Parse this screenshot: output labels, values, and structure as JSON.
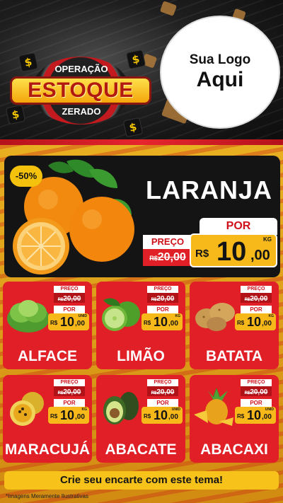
{
  "header": {
    "badge_top": "OPERAÇÃO",
    "badge_main": "ESTOQUE",
    "badge_bottom": "ZERADO",
    "logo_line1": "Sua Logo",
    "logo_line2": "Aqui",
    "dollar_symbol": "$"
  },
  "hero": {
    "discount": "-50%",
    "name": "LARANJA",
    "preco_label": "PREÇO",
    "old_currency": "R$",
    "old_value": "20,00",
    "por_label": "POR",
    "new_currency": "R$",
    "new_int": "10",
    "new_dec": ",00",
    "unit": "KG",
    "icon": "orange-icon"
  },
  "products": [
    {
      "name": "ALFACE",
      "preco_label": "PREÇO",
      "old_currency": "R$",
      "old_value": "20,00",
      "por_label": "POR",
      "new_currency": "R$",
      "new_int": "10",
      "new_dec": ",00",
      "unit": "UNID",
      "icon": "lettuce-icon"
    },
    {
      "name": "LIMÃO",
      "preco_label": "PREÇO",
      "old_currency": "R$",
      "old_value": "20,00",
      "por_label": "POR",
      "new_currency": "R$",
      "new_int": "10",
      "new_dec": ",00",
      "unit": "KG",
      "icon": "lime-icon"
    },
    {
      "name": "BATATA",
      "preco_label": "PREÇO",
      "old_currency": "R$",
      "old_value": "20,00",
      "por_label": "POR",
      "new_currency": "R$",
      "new_int": "10",
      "new_dec": ",00",
      "unit": "KG",
      "icon": "potato-icon"
    },
    {
      "name": "MARACUJÁ",
      "preco_label": "PREÇO",
      "old_currency": "R$",
      "old_value": "20,00",
      "por_label": "POR",
      "new_currency": "R$",
      "new_int": "10",
      "new_dec": ",00",
      "unit": "KG",
      "icon": "passion-fruit-icon"
    },
    {
      "name": "ABACATE",
      "preco_label": "PREÇO",
      "old_currency": "R$",
      "old_value": "20,00",
      "por_label": "POR",
      "new_currency": "R$",
      "new_int": "10",
      "new_dec": ",00",
      "unit": "UNID",
      "icon": "avocado-icon"
    },
    {
      "name": "ABACAXI",
      "preco_label": "PREÇO",
      "old_currency": "R$",
      "old_value": "20,00",
      "por_label": "POR",
      "new_currency": "R$",
      "new_int": "10",
      "new_dec": ",00",
      "unit": "UNID",
      "icon": "pineapple-icon"
    }
  ],
  "footer": {
    "cta": "Crie seu encarte com este tema!",
    "disclaimer": "*Imagens Meramente Ilustrativas"
  },
  "colors": {
    "red": "#e01f27",
    "yellow": "#f7b91a",
    "dark": "#141414"
  }
}
